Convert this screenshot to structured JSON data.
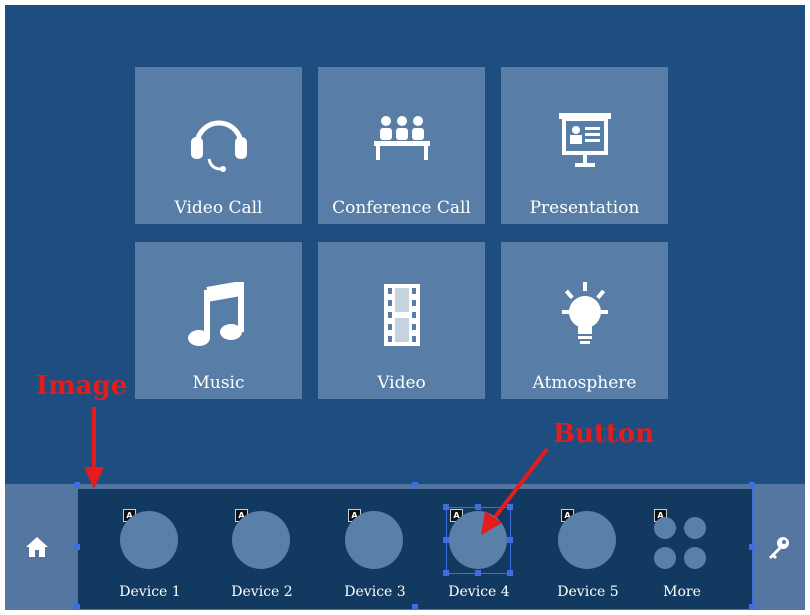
{
  "tiles": [
    {
      "label": "Video Call",
      "icon": "headset-icon"
    },
    {
      "label": "Conference Call",
      "icon": "conference-icon"
    },
    {
      "label": "Presentation",
      "icon": "presentation-icon"
    },
    {
      "label": "Music",
      "icon": "music-note-icon"
    },
    {
      "label": "Video",
      "icon": "film-strip-icon"
    },
    {
      "label": "Atmosphere",
      "icon": "light-bulb-icon"
    }
  ],
  "devices": [
    {
      "label": "Device 1"
    },
    {
      "label": "Device 2"
    },
    {
      "label": "Device 3"
    },
    {
      "label": "Device 4"
    },
    {
      "label": "Device 5"
    },
    {
      "label": "More"
    }
  ],
  "badge_letter": "A",
  "annotations": {
    "image_label": "Image",
    "button_label": "Button"
  },
  "colors": {
    "background": "#1d4e7f",
    "tile": "#587ea7",
    "device_strip": "#12395f",
    "annotation": "#e61b1b",
    "selection": "#3f6ee0"
  }
}
